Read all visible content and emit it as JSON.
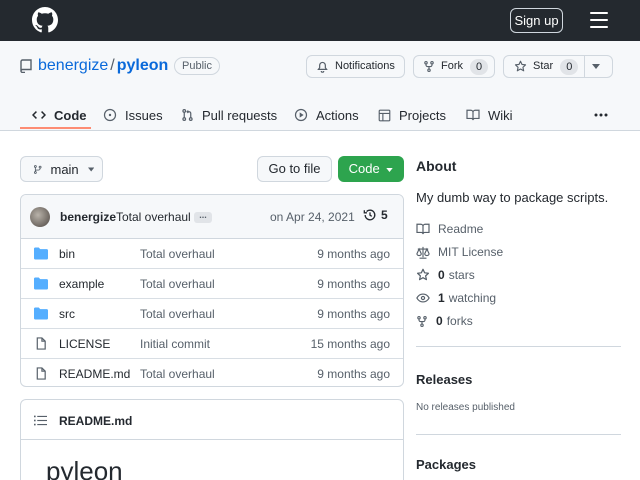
{
  "topbar": {
    "signup_label": "Sign up"
  },
  "repo": {
    "owner": "benergize",
    "separator": "/",
    "name": "pyleon",
    "visibility": "Public",
    "notifications_label": "Notifications",
    "fork_label": "Fork",
    "fork_count": "0",
    "star_label": "Star",
    "star_count": "0"
  },
  "tabs": [
    {
      "label": "Code"
    },
    {
      "label": "Issues"
    },
    {
      "label": "Pull requests"
    },
    {
      "label": "Actions"
    },
    {
      "label": "Projects"
    },
    {
      "label": "Wiki"
    }
  ],
  "toolbar": {
    "branch": "main",
    "go_to_file": "Go to file",
    "code_label": "Code"
  },
  "commit": {
    "author": "benergize",
    "message": "Total overhaul",
    "ellipsis": "...",
    "date": "on Apr 24, 2021",
    "count": "5"
  },
  "files": [
    {
      "type": "dir",
      "name": "bin",
      "message": "Total overhaul",
      "age": "9 months ago"
    },
    {
      "type": "dir",
      "name": "example",
      "message": "Total overhaul",
      "age": "9 months ago"
    },
    {
      "type": "dir",
      "name": "src",
      "message": "Total overhaul",
      "age": "9 months ago"
    },
    {
      "type": "file",
      "name": "LICENSE",
      "message": "Initial commit",
      "age": "15 months ago"
    },
    {
      "type": "file",
      "name": "README.md",
      "message": "Total overhaul",
      "age": "9 months ago"
    }
  ],
  "readme": {
    "filename": "README.md",
    "heading": "pyleon"
  },
  "about": {
    "title": "About",
    "description": "My dumb way to package scripts.",
    "readme_label": "Readme",
    "license_label": "MIT License",
    "stars_count": "0",
    "stars_label": "stars",
    "watching_count": "1",
    "watching_label": "watching",
    "forks_count": "0",
    "forks_label": "forks"
  },
  "releases": {
    "title": "Releases",
    "empty_text": "No releases published"
  },
  "packages": {
    "title": "Packages"
  },
  "colors": {
    "topbar_bg": "#24292f",
    "link_blue": "#0969da",
    "code_button_green": "#2da44e",
    "tab_underline": "#fd8c73",
    "folder_blue": "#54aeff"
  }
}
